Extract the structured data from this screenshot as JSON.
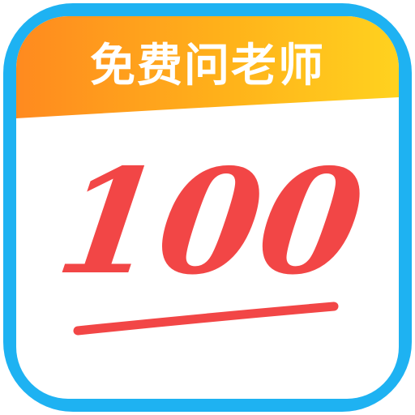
{
  "icon": {
    "banner_label": "免费问老师",
    "score_label": "100",
    "frame_color": "#1EB2F2",
    "banner_gradient": [
      "#FF8A1F",
      "#FFB21A",
      "#FFD21F"
    ],
    "score_color": "#F24646",
    "underline_color": "#F24646",
    "background": "#FFFFFF"
  }
}
